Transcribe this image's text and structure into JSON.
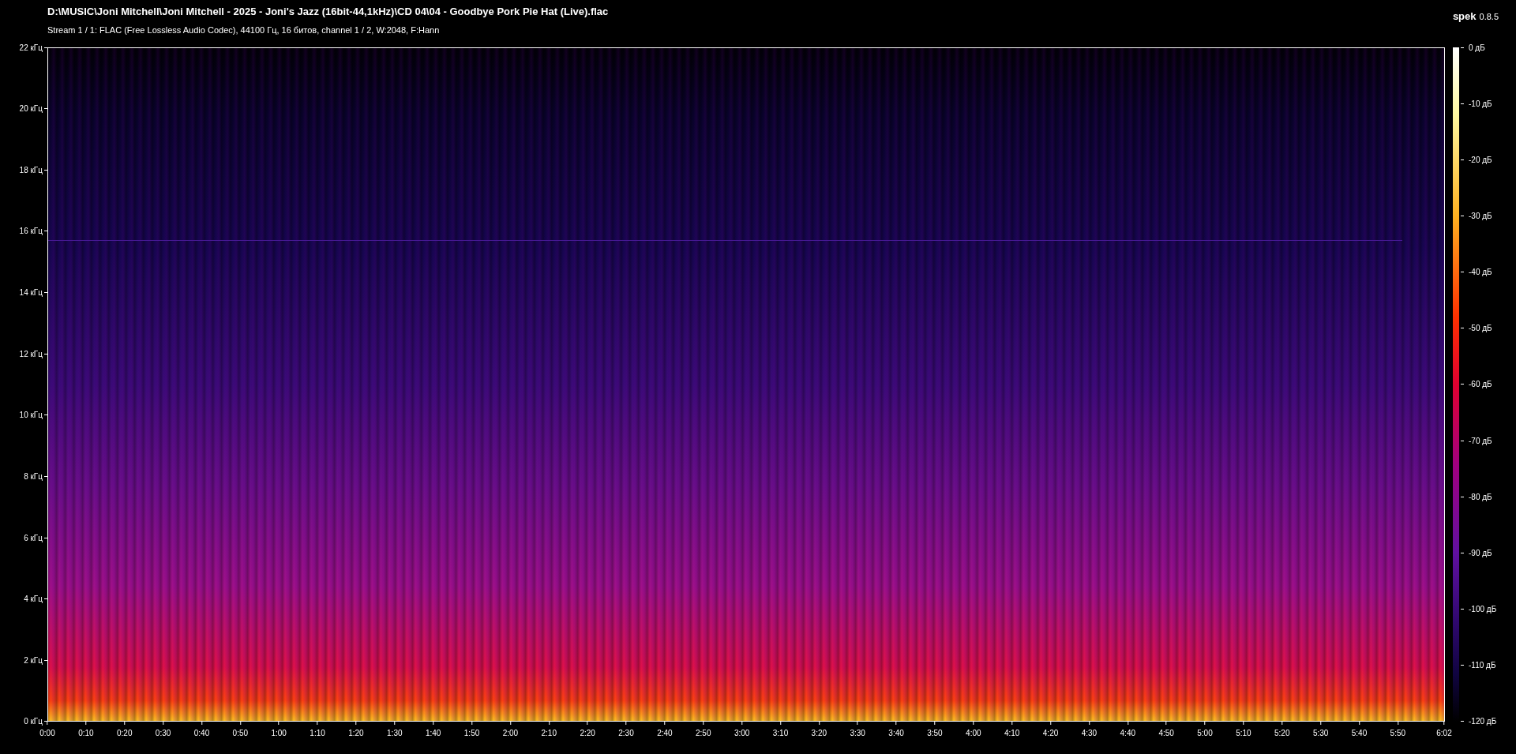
{
  "file_title": "D:\\MUSIC\\Joni Mitchell\\Joni Mitchell - 2025 - Joni's Jazz (16bit-44,1kHz)\\CD 04\\04 - Goodbye Pork Pie Hat (Live).flac",
  "stream_info": "Stream 1 / 1: FLAC (Free Lossless Audio Codec), 44100 Гц, 16 битов, channel 1 / 2, W:2048, F:Hann",
  "app": {
    "name": "spek",
    "version": "0.8.5"
  },
  "frequency_axis": [
    "22 кГц",
    "20 кГц",
    "18 кГц",
    "16 кГц",
    "14 кГц",
    "12 кГц",
    "10 кГц",
    "8 кГц",
    "6 кГц",
    "4 кГц",
    "2 кГц",
    "0 кГц"
  ],
  "time_axis": [
    "0:00",
    "0:10",
    "0:20",
    "0:30",
    "0:40",
    "0:50",
    "1:00",
    "1:10",
    "1:20",
    "1:30",
    "1:40",
    "1:50",
    "2:00",
    "2:10",
    "2:20",
    "2:30",
    "2:40",
    "2:50",
    "3:00",
    "3:10",
    "3:20",
    "3:30",
    "3:40",
    "3:50",
    "4:00",
    "4:10",
    "4:20",
    "4:30",
    "4:40",
    "4:50",
    "5:00",
    "5:10",
    "5:20",
    "5:30",
    "5:40",
    "5:50",
    "6:02"
  ],
  "level_scale": [
    "0 дБ",
    "-10 дБ",
    "-20 дБ",
    "-30 дБ",
    "-40 дБ",
    "-50 дБ",
    "-60 дБ",
    "-70 дБ",
    "-80 дБ",
    "-90 дБ",
    "-100 дБ",
    "-110 дБ",
    "-120 дБ"
  ]
}
